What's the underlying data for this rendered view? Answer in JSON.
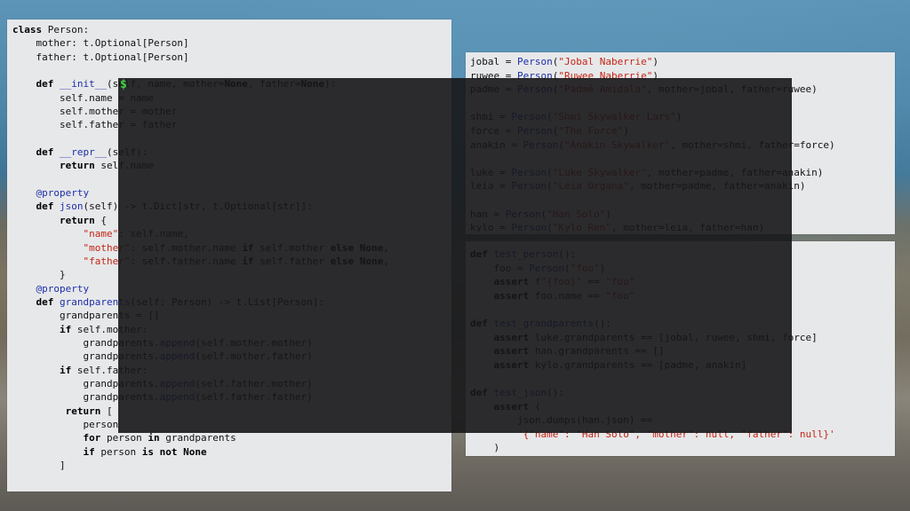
{
  "code_left": {
    "lines": [
      [
        {
          "t": "class",
          "c": "kw"
        },
        {
          "t": " Person:"
        }
      ],
      [
        {
          "t": "    mother: t.Optional[Person]"
        }
      ],
      [
        {
          "t": "    father: t.Optional[Person]"
        }
      ],
      [
        {
          "t": ""
        }
      ],
      [
        {
          "t": "    "
        },
        {
          "t": "def",
          "c": "kw"
        },
        {
          "t": " "
        },
        {
          "t": "__init__",
          "c": "fn"
        },
        {
          "t": "(self, name, mother="
        },
        {
          "t": "None",
          "c": "kw"
        },
        {
          "t": ", father="
        },
        {
          "t": "None",
          "c": "kw"
        },
        {
          "t": "):"
        }
      ],
      [
        {
          "t": "        self.name = name"
        }
      ],
      [
        {
          "t": "        self.mother = mother"
        }
      ],
      [
        {
          "t": "        self.father = father"
        }
      ],
      [
        {
          "t": ""
        }
      ],
      [
        {
          "t": "    "
        },
        {
          "t": "def",
          "c": "kw"
        },
        {
          "t": " "
        },
        {
          "t": "__repr__",
          "c": "fn"
        },
        {
          "t": "(self):"
        }
      ],
      [
        {
          "t": "        "
        },
        {
          "t": "return",
          "c": "kw"
        },
        {
          "t": " self.name"
        }
      ],
      [
        {
          "t": ""
        }
      ],
      [
        {
          "t": "    "
        },
        {
          "t": "@property",
          "c": "fn"
        }
      ],
      [
        {
          "t": "    "
        },
        {
          "t": "def",
          "c": "kw"
        },
        {
          "t": " "
        },
        {
          "t": "json",
          "c": "fn"
        },
        {
          "t": "(self) -> t.Dict[str, t.Optional[str]]:"
        }
      ],
      [
        {
          "t": "        "
        },
        {
          "t": "return",
          "c": "kw"
        },
        {
          "t": " {"
        }
      ],
      [
        {
          "t": "            "
        },
        {
          "t": "\"name\"",
          "c": "str"
        },
        {
          "t": ": self.name,"
        }
      ],
      [
        {
          "t": "            "
        },
        {
          "t": "\"mother\"",
          "c": "str"
        },
        {
          "t": ": self.mother.name "
        },
        {
          "t": "if",
          "c": "kw"
        },
        {
          "t": " self.mother "
        },
        {
          "t": "else",
          "c": "kw"
        },
        {
          "t": " "
        },
        {
          "t": "None",
          "c": "kw"
        },
        {
          "t": ","
        }
      ],
      [
        {
          "t": "            "
        },
        {
          "t": "\"father\"",
          "c": "str"
        },
        {
          "t": ": self.father.name "
        },
        {
          "t": "if",
          "c": "kw"
        },
        {
          "t": " self.father "
        },
        {
          "t": "else",
          "c": "kw"
        },
        {
          "t": " "
        },
        {
          "t": "None",
          "c": "kw"
        },
        {
          "t": ","
        }
      ],
      [
        {
          "t": "        }"
        }
      ],
      [
        {
          "t": "    "
        },
        {
          "t": "@property",
          "c": "fn"
        }
      ],
      [
        {
          "t": "    "
        },
        {
          "t": "def",
          "c": "kw"
        },
        {
          "t": " "
        },
        {
          "t": "grandparents",
          "c": "fn"
        },
        {
          "t": "(self: Person) -> t.List[Person]:"
        }
      ],
      [
        {
          "t": "        grandparents = []"
        }
      ],
      [
        {
          "t": "        "
        },
        {
          "t": "if",
          "c": "kw"
        },
        {
          "t": " self.mother:"
        }
      ],
      [
        {
          "t": "            grandparents."
        },
        {
          "t": "append",
          "c": "fn"
        },
        {
          "t": "(self.mother.mother)"
        }
      ],
      [
        {
          "t": "            grandparents."
        },
        {
          "t": "append",
          "c": "fn"
        },
        {
          "t": "(self.mother.father)"
        }
      ],
      [
        {
          "t": "        "
        },
        {
          "t": "if",
          "c": "kw"
        },
        {
          "t": " self.father:"
        }
      ],
      [
        {
          "t": "            grandparents."
        },
        {
          "t": "append",
          "c": "fn"
        },
        {
          "t": "(self.father.mother)"
        }
      ],
      [
        {
          "t": "            grandparents."
        },
        {
          "t": "append",
          "c": "fn"
        },
        {
          "t": "(self.father.father)"
        }
      ],
      [
        {
          "t": "         "
        },
        {
          "t": "return",
          "c": "kw"
        },
        {
          "t": " ["
        }
      ],
      [
        {
          "t": "            person"
        }
      ],
      [
        {
          "t": "            "
        },
        {
          "t": "for",
          "c": "kw"
        },
        {
          "t": " person "
        },
        {
          "t": "in",
          "c": "kw"
        },
        {
          "t": " grandparents"
        }
      ],
      [
        {
          "t": "            "
        },
        {
          "t": "if",
          "c": "kw"
        },
        {
          "t": " person "
        },
        {
          "t": "is not",
          "c": "kw"
        },
        {
          "t": " "
        },
        {
          "t": "None",
          "c": "kw"
        }
      ],
      [
        {
          "t": "        ]"
        }
      ]
    ]
  },
  "code_right_top": {
    "lines": [
      [
        {
          "t": "jobal = "
        },
        {
          "t": "Person",
          "c": "fn"
        },
        {
          "t": "("
        },
        {
          "t": "\"Jobal Naberrie\"",
          "c": "str"
        },
        {
          "t": ")"
        }
      ],
      [
        {
          "t": "ruwee = "
        },
        {
          "t": "Person",
          "c": "fn"
        },
        {
          "t": "("
        },
        {
          "t": "\"Ruwee Naberrie\"",
          "c": "str"
        },
        {
          "t": ")"
        }
      ],
      [
        {
          "t": "padme = "
        },
        {
          "t": "Person",
          "c": "fn"
        },
        {
          "t": "("
        },
        {
          "t": "\"Padmé Amidala\"",
          "c": "str"
        },
        {
          "t": ", mother=jobal, father=ruwee)"
        }
      ],
      [
        {
          "t": ""
        }
      ],
      [
        {
          "t": "shmi = "
        },
        {
          "t": "Person",
          "c": "fn"
        },
        {
          "t": "("
        },
        {
          "t": "\"Shmi Skywalker Lars\"",
          "c": "str"
        },
        {
          "t": ")"
        }
      ],
      [
        {
          "t": "force = "
        },
        {
          "t": "Person",
          "c": "fn"
        },
        {
          "t": "("
        },
        {
          "t": "\"The Force\"",
          "c": "str"
        },
        {
          "t": ")"
        }
      ],
      [
        {
          "t": "anakin = "
        },
        {
          "t": "Person",
          "c": "fn"
        },
        {
          "t": "("
        },
        {
          "t": "\"Anakin Skywalker\"",
          "c": "str"
        },
        {
          "t": ", mother=shmi, father=force)"
        }
      ],
      [
        {
          "t": ""
        }
      ],
      [
        {
          "t": "luke = "
        },
        {
          "t": "Person",
          "c": "fn"
        },
        {
          "t": "("
        },
        {
          "t": "\"Luke Skywalker\"",
          "c": "str"
        },
        {
          "t": ", mother=padme, father=anakin)"
        }
      ],
      [
        {
          "t": "leia = "
        },
        {
          "t": "Person",
          "c": "fn"
        },
        {
          "t": "("
        },
        {
          "t": "\"Leia Organa\"",
          "c": "str"
        },
        {
          "t": ", mother=padme, father=anakin)"
        }
      ],
      [
        {
          "t": ""
        }
      ],
      [
        {
          "t": "han = "
        },
        {
          "t": "Person",
          "c": "fn"
        },
        {
          "t": "("
        },
        {
          "t": "\"Han Solo\"",
          "c": "str"
        },
        {
          "t": ")"
        }
      ],
      [
        {
          "t": "kylo = "
        },
        {
          "t": "Person",
          "c": "fn"
        },
        {
          "t": "("
        },
        {
          "t": "\"Kylo Ren\"",
          "c": "str"
        },
        {
          "t": ", mother=leia, father=han)"
        }
      ]
    ]
  },
  "code_right_bottom": {
    "lines": [
      [
        {
          "t": "def",
          "c": "kw"
        },
        {
          "t": " "
        },
        {
          "t": "test_person",
          "c": "fn"
        },
        {
          "t": "():"
        }
      ],
      [
        {
          "t": "    foo = "
        },
        {
          "t": "Person",
          "c": "fn"
        },
        {
          "t": "("
        },
        {
          "t": "\"foo\"",
          "c": "str"
        },
        {
          "t": ")"
        }
      ],
      [
        {
          "t": "    "
        },
        {
          "t": "assert",
          "c": "kw"
        },
        {
          "t": " f"
        },
        {
          "t": "\"{foo}\"",
          "c": "str"
        },
        {
          "t": " == "
        },
        {
          "t": "\"foo\"",
          "c": "str"
        }
      ],
      [
        {
          "t": "    "
        },
        {
          "t": "assert",
          "c": "kw"
        },
        {
          "t": " foo.name == "
        },
        {
          "t": "\"foo\"",
          "c": "str"
        }
      ],
      [
        {
          "t": ""
        }
      ],
      [
        {
          "t": "def",
          "c": "kw"
        },
        {
          "t": " "
        },
        {
          "t": "test_grandparents",
          "c": "fn"
        },
        {
          "t": "():"
        }
      ],
      [
        {
          "t": "    "
        },
        {
          "t": "assert",
          "c": "kw"
        },
        {
          "t": " luke.grandparents == [jobal, ruwee, shmi, force]"
        }
      ],
      [
        {
          "t": "    "
        },
        {
          "t": "assert",
          "c": "kw"
        },
        {
          "t": " han.grandparents == []"
        }
      ],
      [
        {
          "t": "    "
        },
        {
          "t": "assert",
          "c": "kw"
        },
        {
          "t": " kylo.grandparents == [padme, anakin]"
        }
      ],
      [
        {
          "t": ""
        }
      ],
      [
        {
          "t": "def",
          "c": "kw"
        },
        {
          "t": " "
        },
        {
          "t": "test_json",
          "c": "fn"
        },
        {
          "t": "():"
        }
      ],
      [
        {
          "t": "    "
        },
        {
          "t": "assert",
          "c": "kw"
        },
        {
          "t": " ("
        }
      ],
      [
        {
          "t": "        json.dumps(han.json) =="
        }
      ],
      [
        {
          "t": "        "
        },
        {
          "t": "'{\"name\": \"Han Solo\", \"mother\": null, \"father\": null}'",
          "c": "str"
        }
      ],
      [
        {
          "t": "    )"
        }
      ]
    ]
  },
  "terminal": {
    "prompt": "$"
  }
}
